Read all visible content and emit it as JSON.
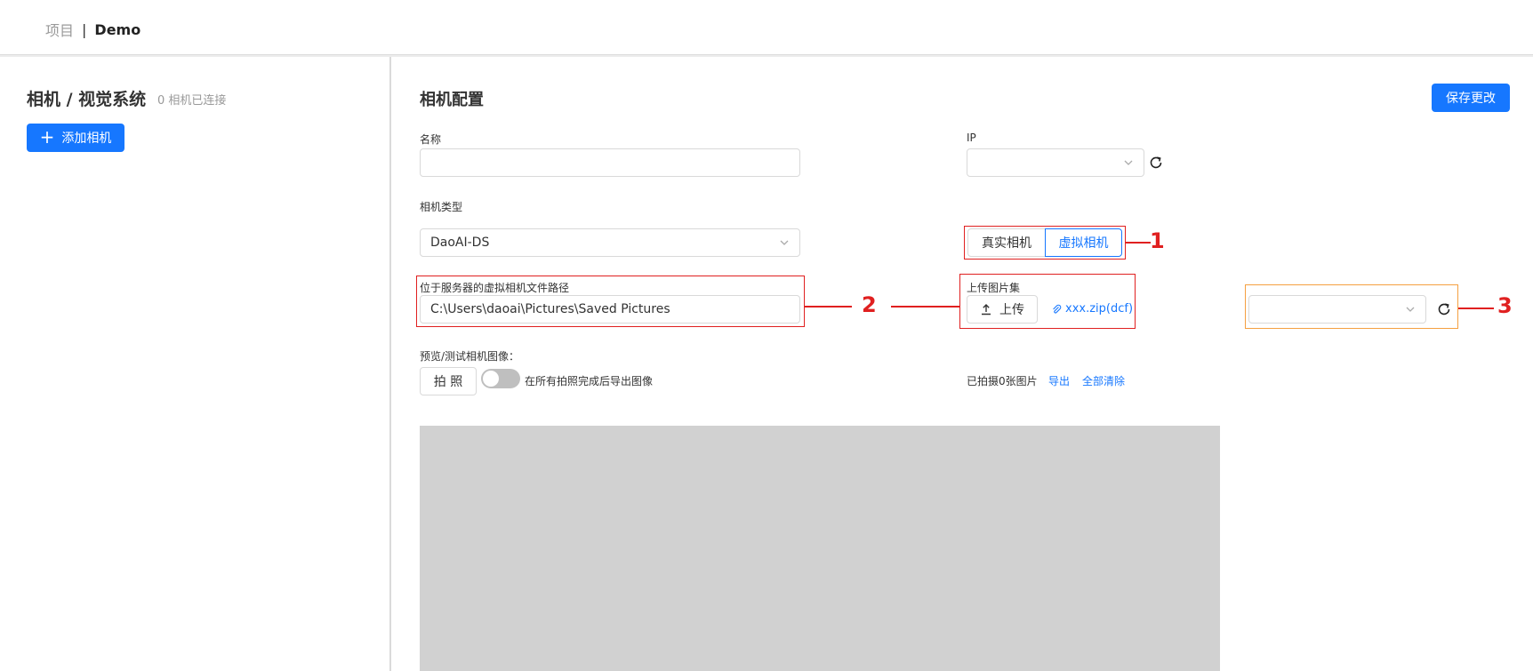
{
  "breadcrumb": {
    "project": "项目",
    "separator": "|",
    "current": "Demo"
  },
  "left_panel": {
    "title": "相机 / 视觉系统",
    "subtitle": "0 相机已连接",
    "add_button": "添加相机"
  },
  "config": {
    "title": "相机配置",
    "save_button": "保存更改",
    "name_label": "名称",
    "name_value": "",
    "ip_label": "IP",
    "ip_value": "",
    "camera_type_label": "相机类型",
    "camera_type_value": "DaoAI-DS",
    "mode_options": [
      "真实相机",
      "虚拟相机"
    ],
    "mode_selected": "虚拟相机",
    "virtual_path_label": "位于服务器的虚拟相机文件路径",
    "virtual_path_value": "C:\\Users\\daoai\\Pictures\\Saved Pictures",
    "upload_label": "上传图片集",
    "upload_button": "上传",
    "uploaded_file": "xxx.zip(dcf)",
    "image_set_select_value": "",
    "preview_label": "预览/测试相机图像：",
    "capture_button": "拍 照",
    "export_toggle_label": "在所有拍照完成后导出图像",
    "export_toggle_on": false,
    "captured_count_text": "已拍摄0张图片",
    "export_link": "导出",
    "clear_all_link": "全部清除"
  },
  "annotations": [
    "1",
    "2",
    "3"
  ],
  "colors": {
    "primary": "#1677ff",
    "annotation_red": "#e02020",
    "annotation_orange": "#f5a040",
    "preview_bg": "#d1d1d1"
  }
}
